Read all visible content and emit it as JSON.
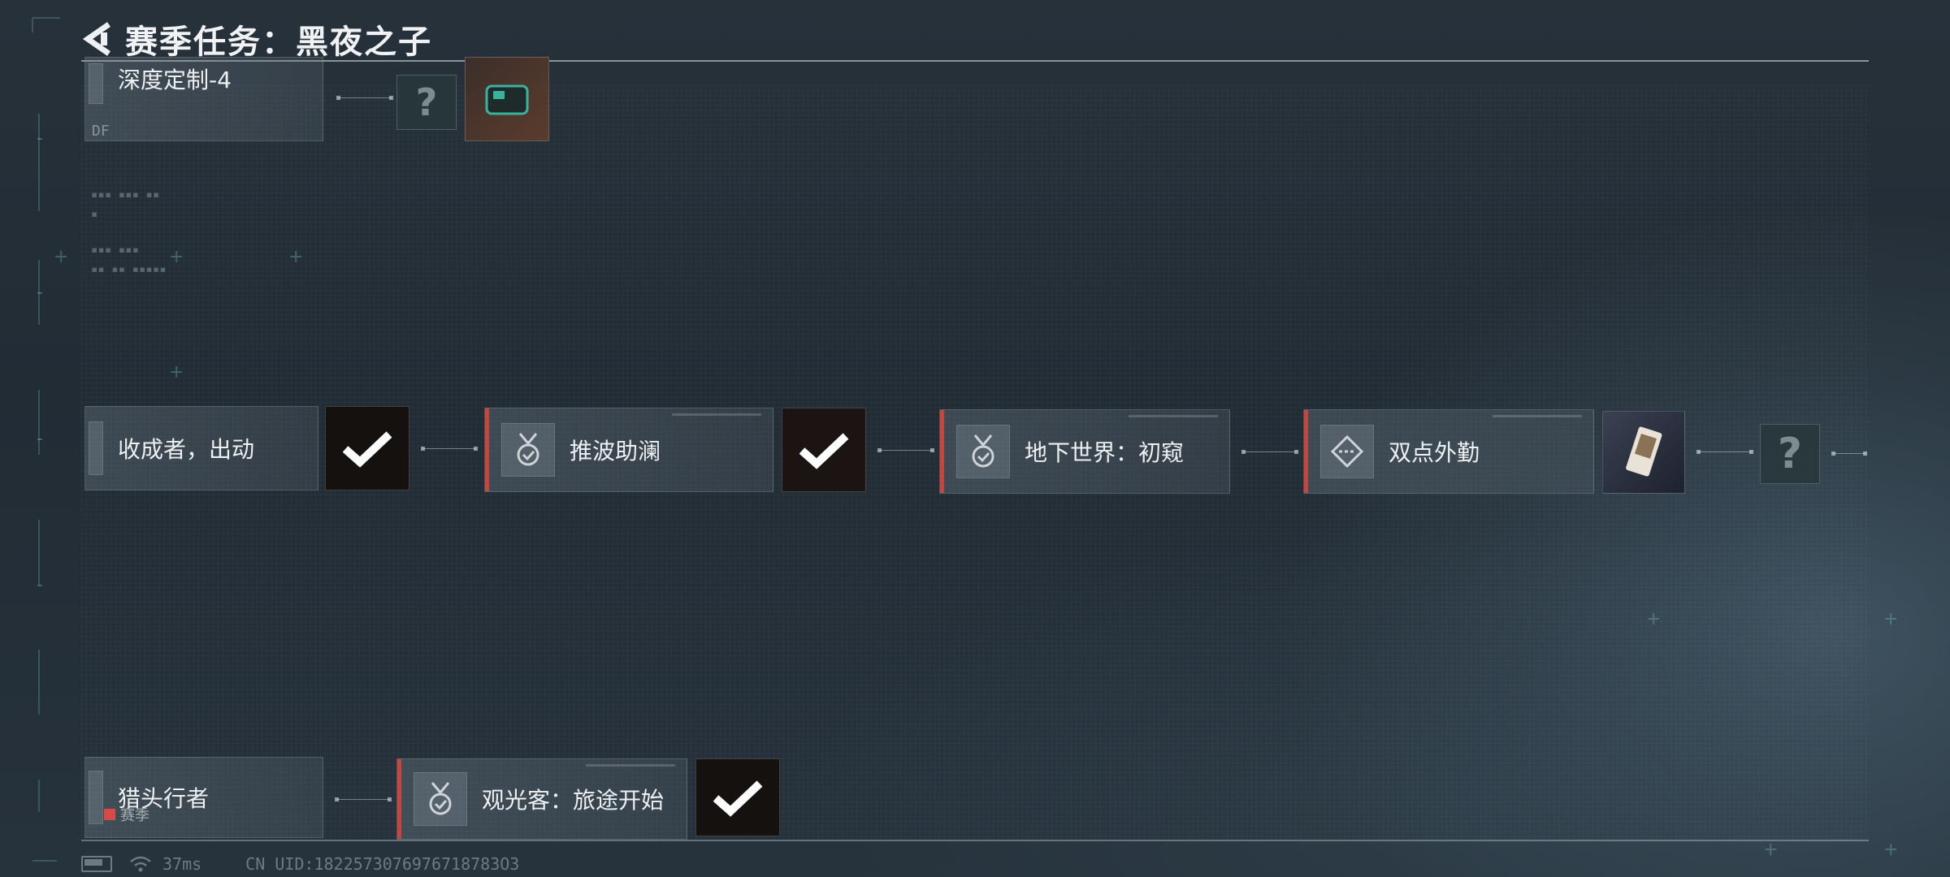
{
  "header": {
    "title": "赛季任务：黑夜之子"
  },
  "top_row": {
    "card_label": "深度定制-4",
    "sub_text": "DF",
    "reward_unknown": "?"
  },
  "middle_row": [
    {
      "label": "收成者，出动",
      "icon": "medal-check-icon",
      "reward": "completed"
    },
    {
      "label": "推波助澜",
      "icon": "medal-check-icon",
      "reward": "completed"
    },
    {
      "label": "地下世界：初窥",
      "icon": "medal-check-icon",
      "reward": "none"
    },
    {
      "label": "双点外勤",
      "icon": "diamond-route-icon",
      "reward": "card-item"
    },
    {
      "unknown": "?"
    }
  ],
  "bottom_row": [
    {
      "label": "猎头行者",
      "icon": "medal-check-icon"
    },
    {
      "label": "观光客：旅途开始",
      "icon": "medal-check-icon",
      "reward": "completed"
    }
  ],
  "season_tag": "赛季",
  "footer": {
    "ping": "37ms",
    "uid": "CN UID:1822573076976718783O3"
  },
  "colors": {
    "accent_red": "#c9453b",
    "check_white": "#ffffff"
  }
}
